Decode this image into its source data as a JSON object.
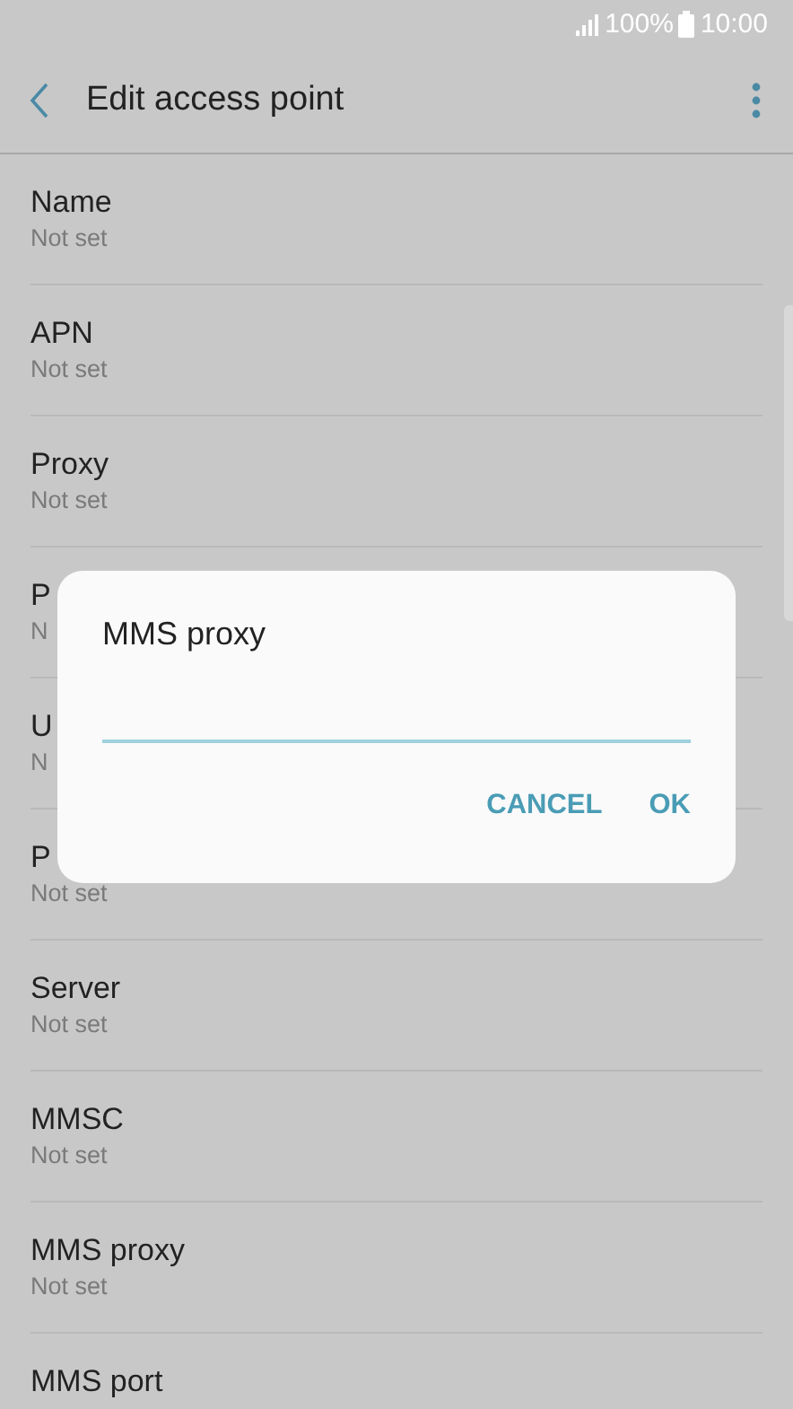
{
  "status_bar": {
    "battery": "100%",
    "time": "10:00"
  },
  "header": {
    "title": "Edit access point"
  },
  "settings": [
    {
      "title": "Name",
      "value": "Not set"
    },
    {
      "title": "APN",
      "value": "Not set"
    },
    {
      "title": "Proxy",
      "value": "Not set"
    },
    {
      "title": "P",
      "value": "N"
    },
    {
      "title": "U",
      "value": "N"
    },
    {
      "title": "P",
      "value": "Not set"
    },
    {
      "title": "Server",
      "value": "Not set"
    },
    {
      "title": "MMSC",
      "value": "Not set"
    },
    {
      "title": "MMS proxy",
      "value": "Not set"
    },
    {
      "title": "MMS port"
    }
  ],
  "dialog": {
    "title": "MMS proxy",
    "buttons": [
      "CANCEL",
      "OK"
    ]
  }
}
